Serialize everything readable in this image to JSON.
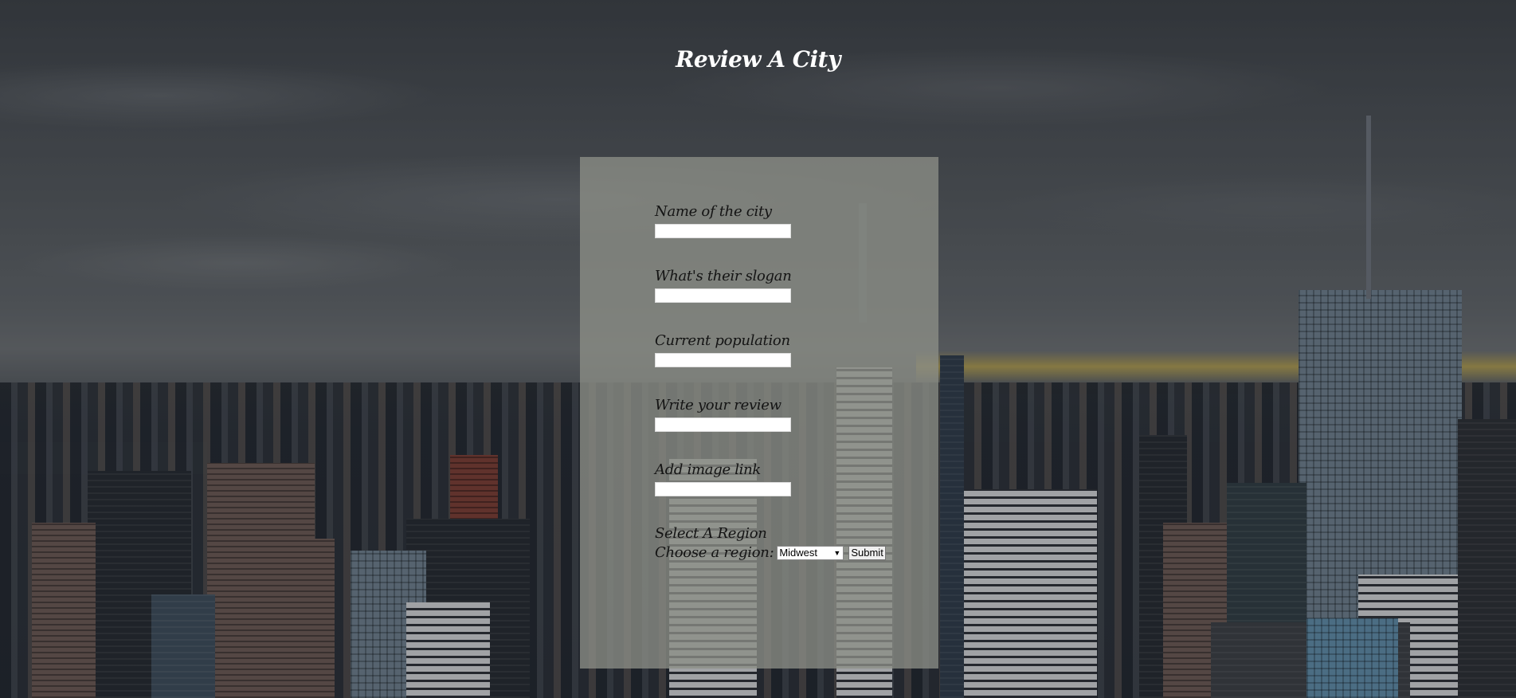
{
  "header": {
    "title": "Review A City"
  },
  "form": {
    "fields": [
      {
        "label": "Name of the city",
        "value": ""
      },
      {
        "label": "What's their slogan",
        "value": ""
      },
      {
        "label": "Current population",
        "value": ""
      },
      {
        "label": "Write your review",
        "value": ""
      },
      {
        "label": "Add image link",
        "value": ""
      }
    ],
    "region": {
      "section_title": "Select A Region",
      "label": "Choose a region:",
      "selected": "Midwest"
    },
    "submit_label": "Submit"
  },
  "colors": {
    "title_text": "#ffffff",
    "panel_background": "#8c8e86",
    "label_text": "#141414"
  }
}
